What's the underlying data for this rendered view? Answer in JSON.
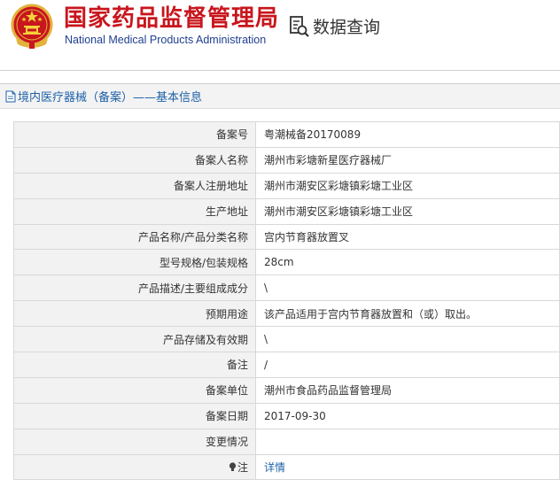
{
  "header": {
    "agency_name_cn": "国家药品监督管理局",
    "agency_name_en": "National Medical Products Administration",
    "query_title": "数据查询"
  },
  "section": {
    "title": "境内医疗器械（备案）——基本信息"
  },
  "rows": [
    {
      "label": "备案号",
      "value": "粤潮械备20170089"
    },
    {
      "label": "备案人名称",
      "value": "潮州市彩塘新星医疗器械厂"
    },
    {
      "label": "备案人注册地址",
      "value": "潮州市潮安区彩塘镇彩塘工业区"
    },
    {
      "label": "生产地址",
      "value": "潮州市潮安区彩塘镇彩塘工业区"
    },
    {
      "label": "产品名称/产品分类名称",
      "value": "宫内节育器放置叉"
    },
    {
      "label": "型号规格/包装规格",
      "value": "28cm"
    },
    {
      "label": "产品描述/主要组成成分",
      "value": "\\"
    },
    {
      "label": "预期用途",
      "value": "该产品适用于宫内节育器放置和（或）取出。"
    },
    {
      "label": "产品存储及有效期",
      "value": "\\"
    },
    {
      "label": "备注",
      "value": "/"
    },
    {
      "label": "备案单位",
      "value": "潮州市食品药品监督管理局"
    },
    {
      "label": "备案日期",
      "value": "2017-09-30"
    },
    {
      "label": "变更情况",
      "value": ""
    }
  ],
  "note_row": {
    "label": "注",
    "link_text": "详情",
    "icon": "lightbulb-icon"
  },
  "colors": {
    "brand_red": "#c8161d",
    "brand_blue": "#1f3f8f",
    "link_blue": "#1d61a8",
    "label_bg": "#f2f2f2"
  }
}
